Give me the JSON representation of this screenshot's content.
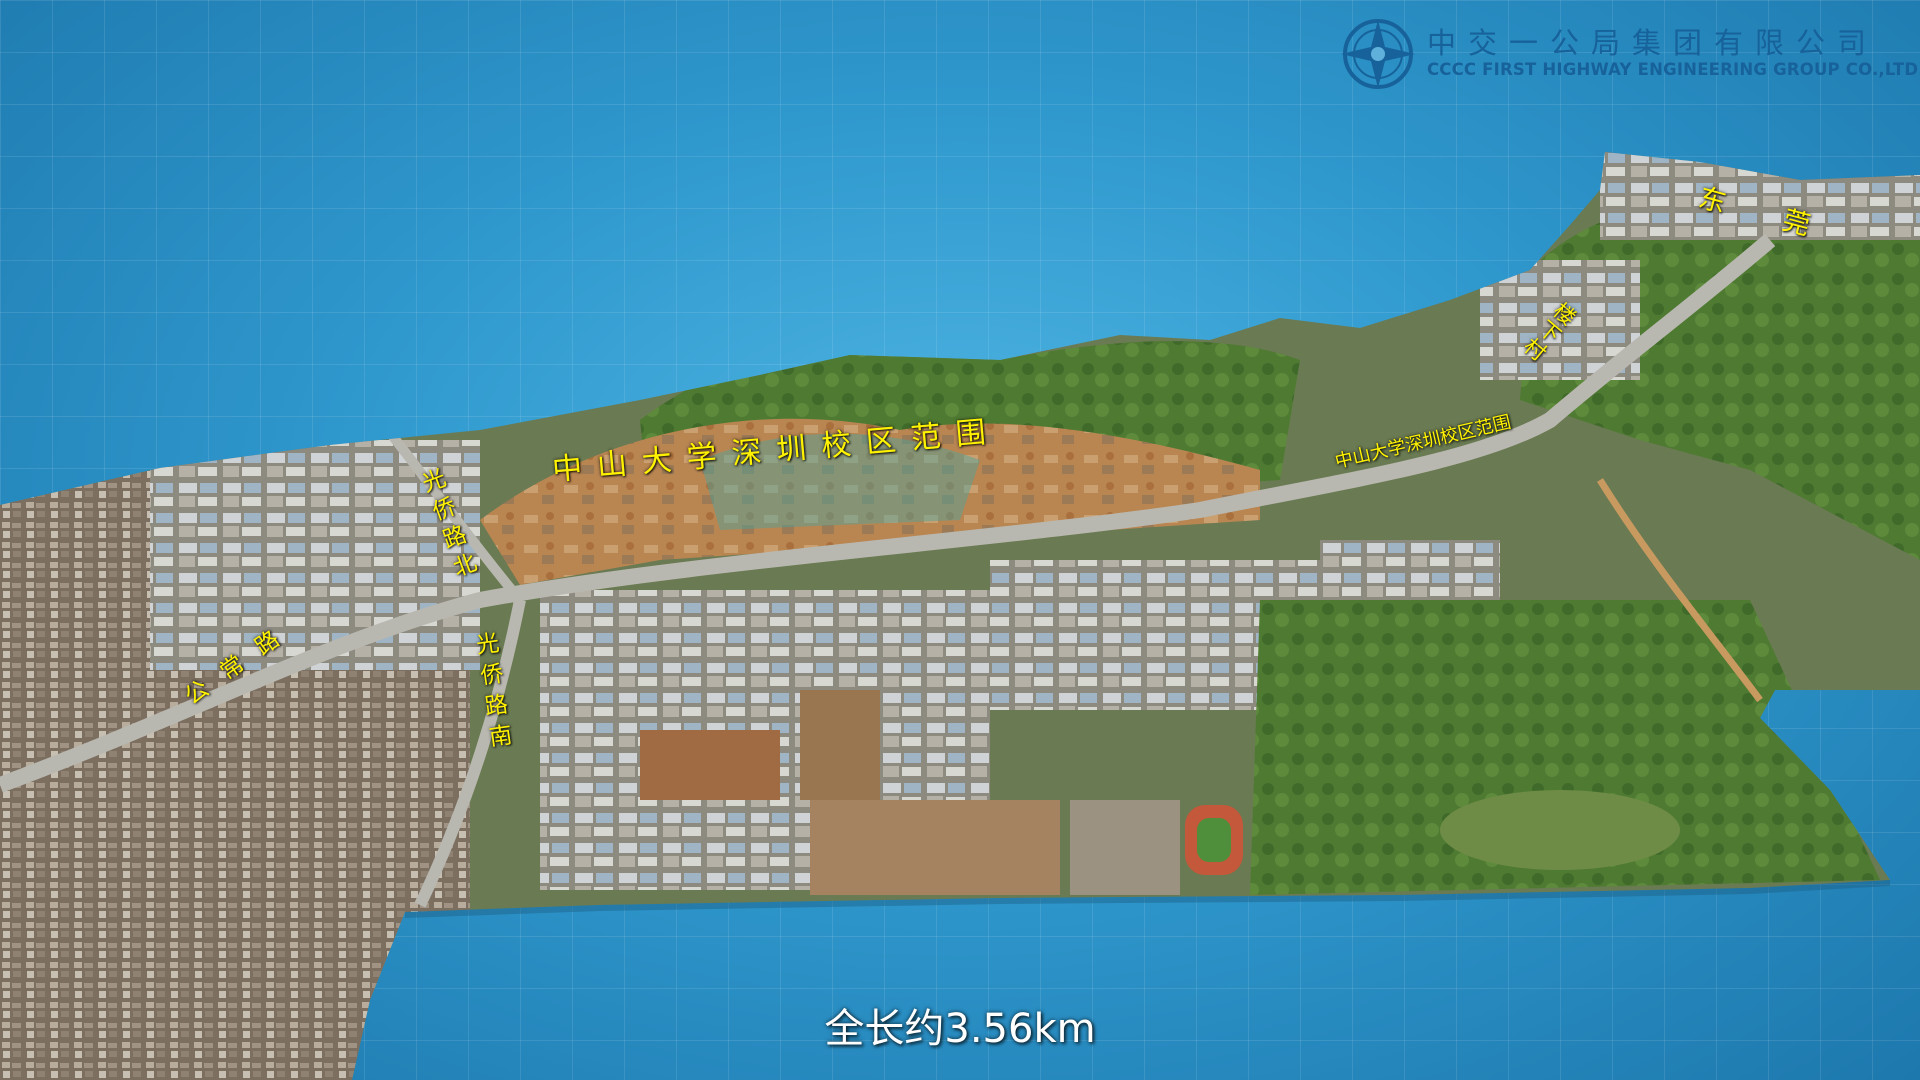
{
  "company": {
    "name_cn": "中交一公局集团有限公司",
    "name_en": "CCCC FIRST HIGHWAY ENGINEERING GROUP CO.,LTD."
  },
  "labels": {
    "campus_large": "中山大学深圳校区范围",
    "campus_small": "中山大学深圳校区范围",
    "road_guangqiao_north": "光侨路北",
    "road_guangqiao_south": "光侨路南",
    "road_gongchang": "公常路",
    "dongguan": "东莞",
    "village": "楼下村"
  },
  "caption": "全长约3.56km",
  "colors": {
    "background": "#2f98cd",
    "label": "#fff200",
    "logo": "#17629a",
    "road": "#b9b8b0"
  }
}
